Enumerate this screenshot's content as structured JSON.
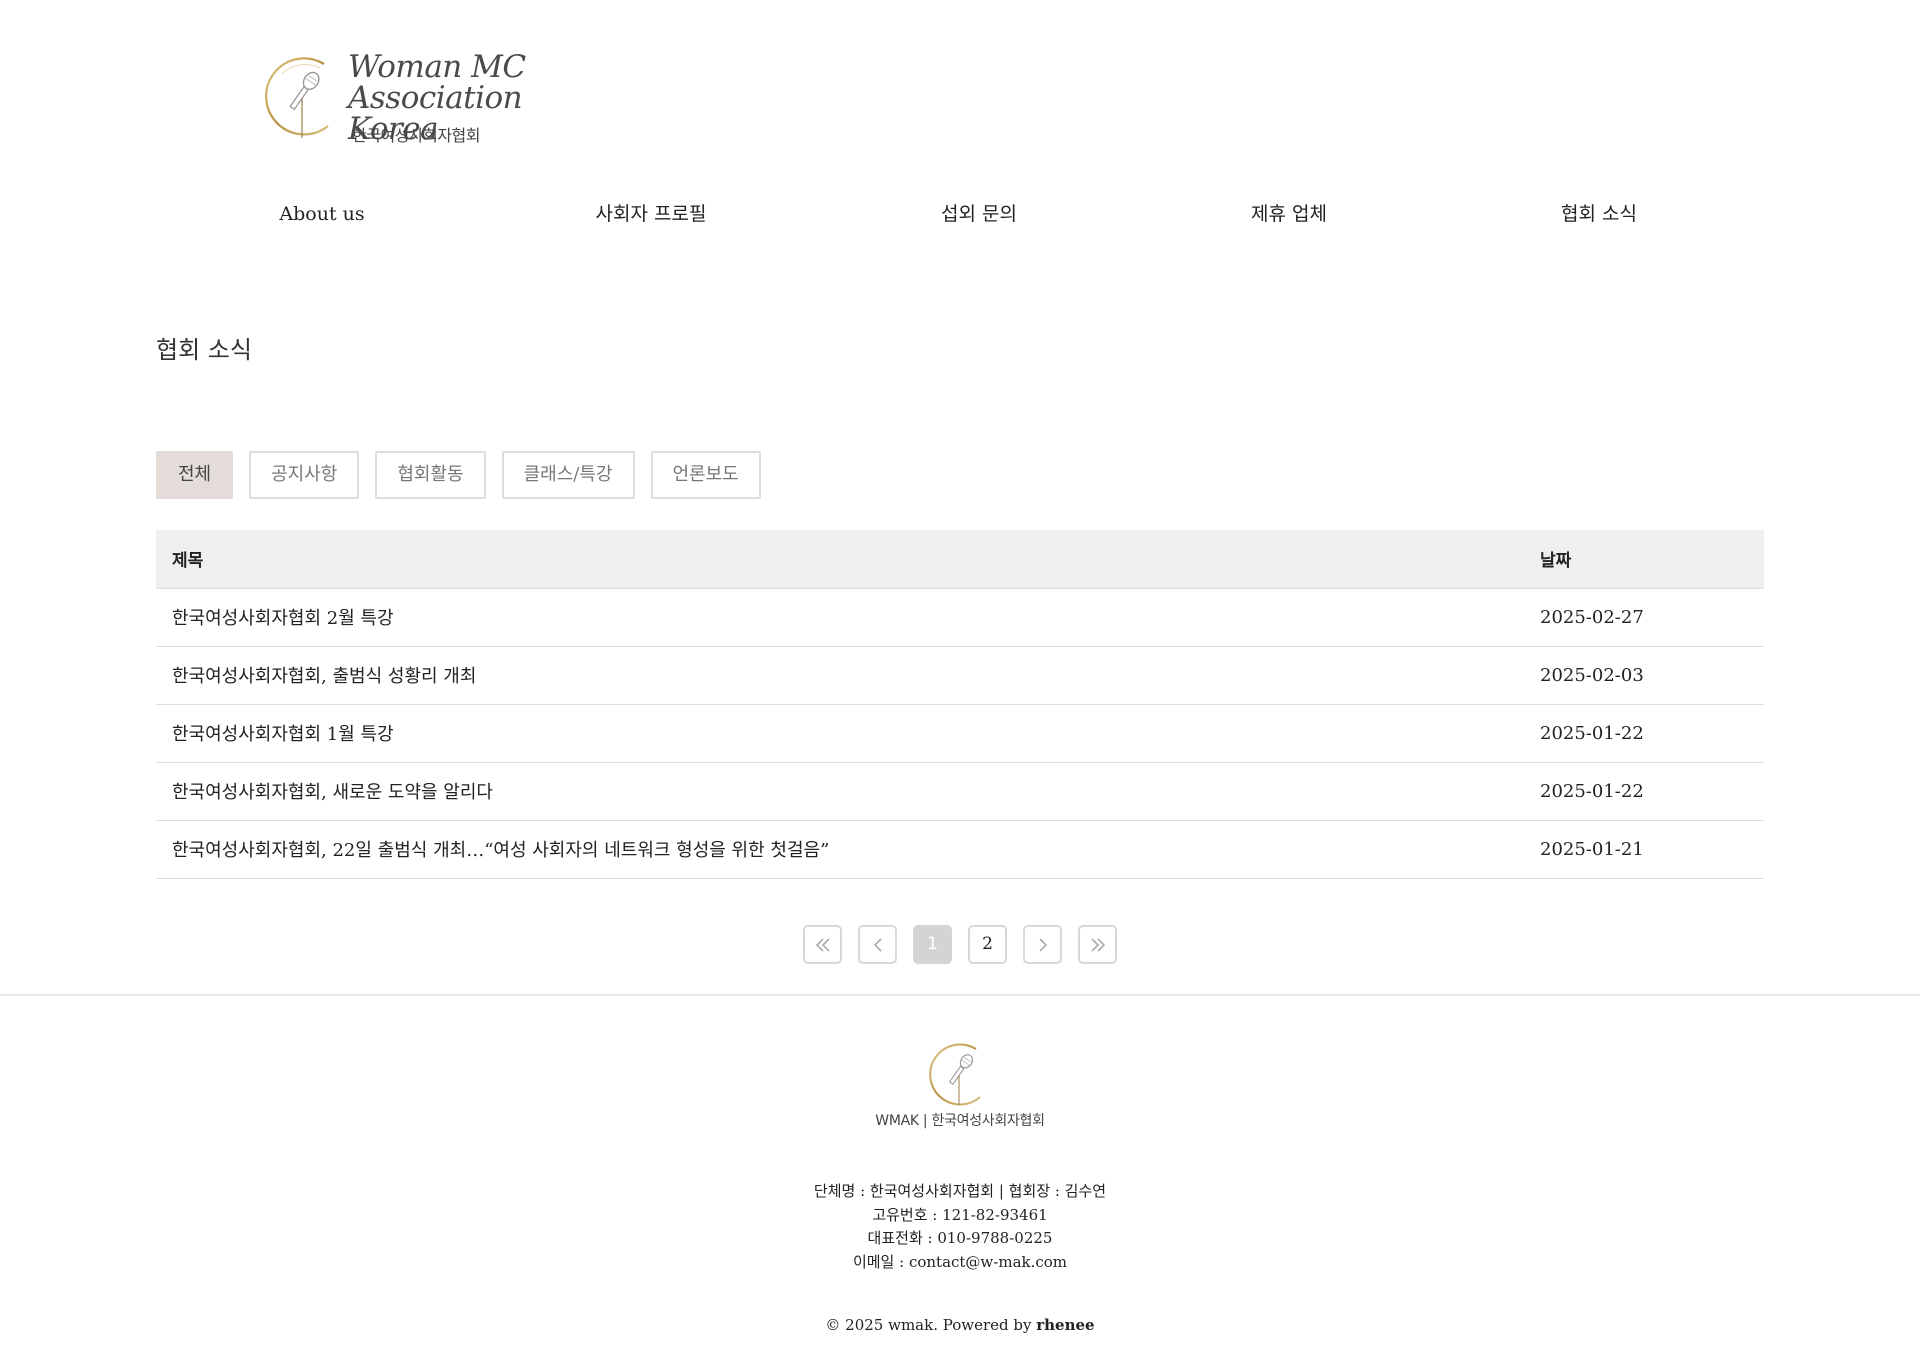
{
  "logo": {
    "text_en": "Woman MC\nAssociation Korea",
    "text_ko": "한국여성사회자협회"
  },
  "nav": {
    "items": [
      {
        "label": "About us"
      },
      {
        "label": "사회자 프로필"
      },
      {
        "label": "섭외 문의"
      },
      {
        "label": "제휴 업체"
      },
      {
        "label": "협회 소식"
      }
    ]
  },
  "page": {
    "title": "협회 소식"
  },
  "filters": {
    "items": [
      {
        "label": "전체",
        "active": true
      },
      {
        "label": "공지사항",
        "active": false
      },
      {
        "label": "협회활동",
        "active": false
      },
      {
        "label": "클래스/특강",
        "active": false
      },
      {
        "label": "언론보도",
        "active": false
      }
    ]
  },
  "board": {
    "columns": {
      "title": "제목",
      "date": "날짜"
    },
    "rows": [
      {
        "title": "한국여성사회자협회 2월 특강",
        "date": "2025-02-27"
      },
      {
        "title": "한국여성사회자협회, 출범식 성황리 개최",
        "date": "2025-02-03"
      },
      {
        "title": "한국여성사회자협회 1월 특강",
        "date": "2025-01-22"
      },
      {
        "title": "한국여성사회자협회, 새로운 도약을 알리다",
        "date": "2025-01-22"
      },
      {
        "title": "한국여성사회자협회, 22일 출범식 개최…“여성 사회자의 네트워크 형성을 위한 첫걸음”",
        "date": "2025-01-21"
      }
    ]
  },
  "pagination": {
    "pages": [
      "1",
      "2"
    ],
    "current": "1",
    "icons": {
      "first": "double-chevron-left-icon",
      "prev": "chevron-left-icon",
      "next": "chevron-right-icon",
      "last": "double-chevron-right-icon"
    }
  },
  "footer": {
    "brand": "WMAK | 한국여성사회자협회",
    "info": {
      "org": "단체명 : 한국여성사회자협회 | 협회장 : 김수연",
      "reg": "고유번호 : 121-82-93461",
      "phone": "대표전화 : 010-9788-0225",
      "email": "이메일 : contact@w-mak.com"
    },
    "copyright_prefix": "© 2025 wmak. Powered by ",
    "powered_by": "rhenee"
  },
  "colors": {
    "gold": "#c9a45c",
    "active_filter": "#e4dcd8",
    "table_header": "#efefef"
  }
}
